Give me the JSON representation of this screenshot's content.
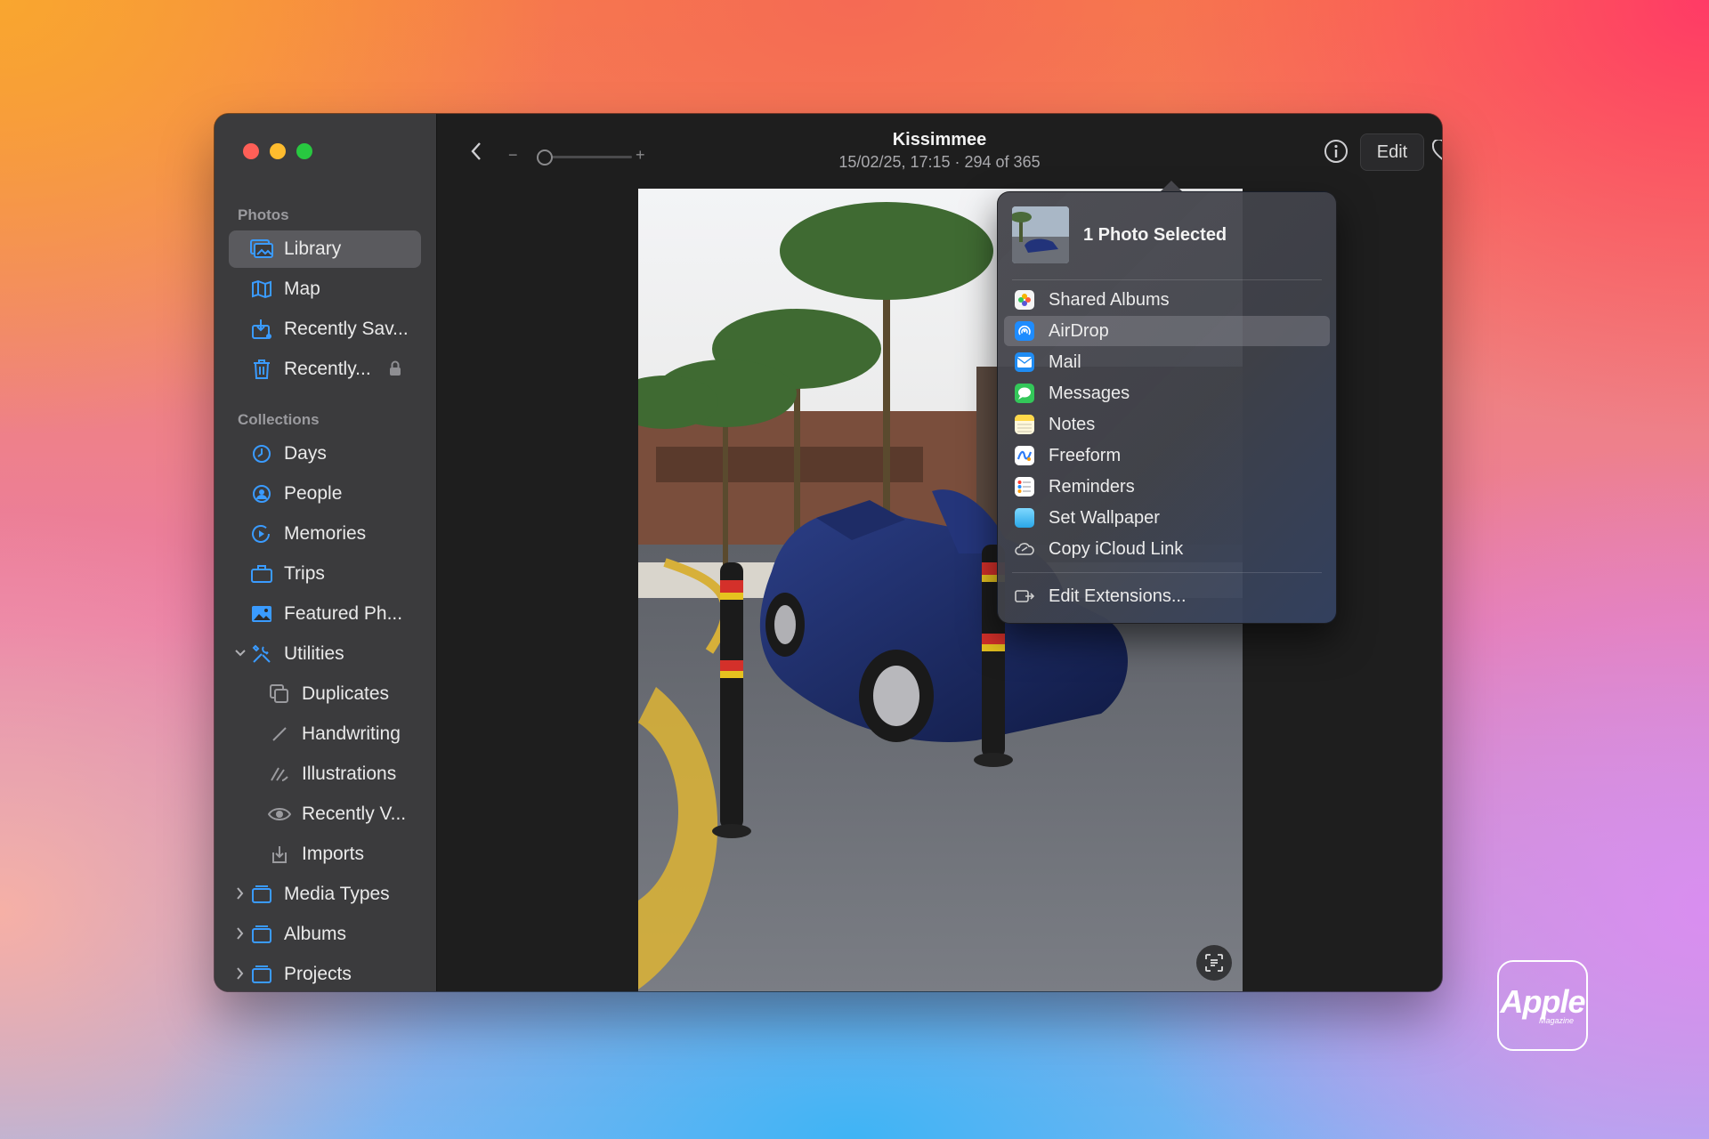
{
  "window": {
    "title": "Kissimmee",
    "subtitle": "15/02/25, 17:15  ·  294 of 365",
    "edit_label": "Edit"
  },
  "sidebar": {
    "photos_header": "Photos",
    "photos_items": [
      {
        "label": "Library",
        "icon": "library-icon",
        "active": true
      },
      {
        "label": "Map",
        "icon": "map-icon"
      },
      {
        "label": "Recently Sav...",
        "icon": "recently-saved-icon"
      },
      {
        "label": "Recently...",
        "icon": "trash-icon",
        "locked": true
      }
    ],
    "collections_header": "Collections",
    "collections_items": [
      {
        "label": "Days",
        "icon": "clock-icon"
      },
      {
        "label": "People",
        "icon": "person-icon"
      },
      {
        "label": "Memories",
        "icon": "memories-icon"
      },
      {
        "label": "Trips",
        "icon": "suitcase-icon"
      },
      {
        "label": "Featured Ph...",
        "icon": "featured-photos-icon"
      },
      {
        "label": "Utilities",
        "icon": "tools-icon",
        "expanded": true
      }
    ],
    "utilities_items": [
      {
        "label": "Duplicates",
        "icon": "duplicates-icon"
      },
      {
        "label": "Handwriting",
        "icon": "pen-icon"
      },
      {
        "label": "Illustrations",
        "icon": "illustrations-icon"
      },
      {
        "label": "Recently V...",
        "icon": "eye-icon"
      },
      {
        "label": "Imports",
        "icon": "import-icon"
      }
    ],
    "groups": [
      {
        "label": "Media Types",
        "icon": "folder-icon"
      },
      {
        "label": "Albums",
        "icon": "folder-icon"
      },
      {
        "label": "Projects",
        "icon": "folder-icon"
      }
    ]
  },
  "share_menu": {
    "header": "1 Photo Selected",
    "items": [
      {
        "label": "Shared Albums",
        "icon": "shared-albums-icon",
        "color": "#f5f5f5"
      },
      {
        "label": "AirDrop",
        "icon": "airdrop-icon",
        "color": "#1e8cff",
        "highlighted": true
      },
      {
        "label": "Mail",
        "icon": "mail-icon",
        "color": "#1f8cf3"
      },
      {
        "label": "Messages",
        "icon": "messages-icon",
        "color": "#33c759"
      },
      {
        "label": "Notes",
        "icon": "notes-icon",
        "color": "#ffd84a"
      },
      {
        "label": "Freeform",
        "icon": "freeform-icon",
        "color": "#ffffff"
      },
      {
        "label": "Reminders",
        "icon": "reminders-icon",
        "color": "#ffffff"
      },
      {
        "label": "Set Wallpaper",
        "icon": "wallpaper-icon",
        "color": "#5ac8fa"
      },
      {
        "label": "Copy iCloud Link",
        "icon": "icloud-link-icon",
        "color": "#cfcfcf"
      }
    ],
    "extensions_label": "Edit Extensions..."
  },
  "watermark": {
    "brand": "Apple",
    "sub": "Magazine"
  }
}
